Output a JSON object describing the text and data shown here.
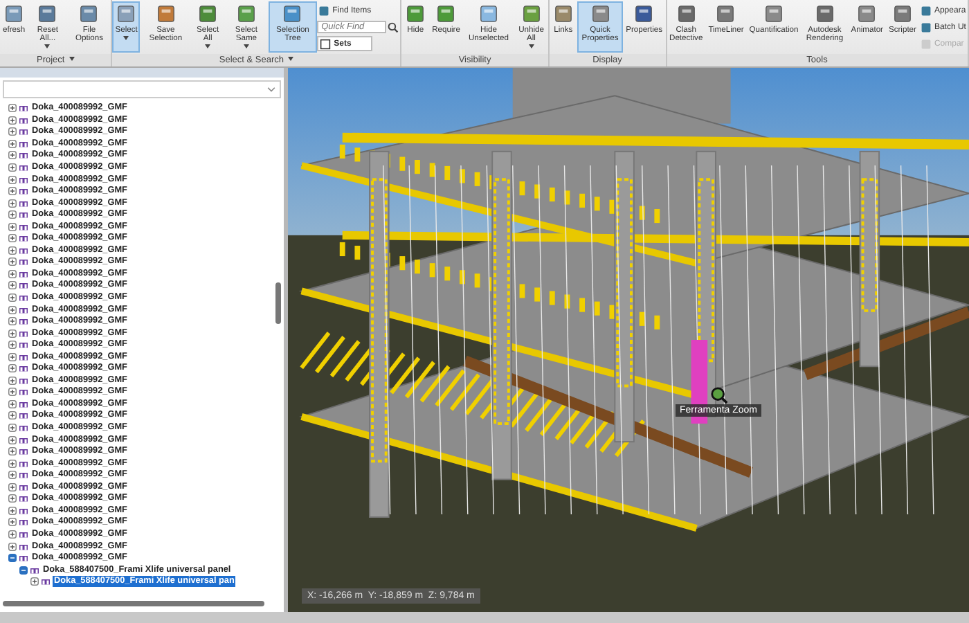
{
  "ribbon": {
    "groups": [
      {
        "label": "Project",
        "menu": true,
        "items": [
          {
            "kind": "large",
            "label": "efresh",
            "selected": false,
            "arrow": false
          },
          {
            "kind": "large",
            "label": "Reset All...",
            "selected": false,
            "arrow": true
          },
          {
            "kind": "large",
            "label": "File Options",
            "selected": false,
            "arrow": false
          }
        ]
      },
      {
        "label": "Select & Search",
        "menu": true,
        "items": [
          {
            "kind": "large",
            "label": "Select",
            "selected": true,
            "arrow": true
          },
          {
            "kind": "large",
            "label": "Save Selection",
            "selected": false,
            "arrow": false
          },
          {
            "kind": "large",
            "label": "Select All",
            "selected": false,
            "arrow": true
          },
          {
            "kind": "large",
            "label": "Select Same",
            "selected": false,
            "arrow": true
          },
          {
            "kind": "large",
            "label": "Selection Tree",
            "selected": true,
            "arrow": false
          },
          {
            "kind": "column",
            "items": [
              {
                "kind": "small",
                "label": "Find Items",
                "disabled": false
              },
              {
                "kind": "search",
                "placeholder": "Quick Find"
              },
              {
                "kind": "dropdown",
                "label": "Sets"
              }
            ]
          }
        ]
      },
      {
        "label": "Visibility",
        "menu": false,
        "items": [
          {
            "kind": "large",
            "label": "Hide",
            "selected": false,
            "arrow": false
          },
          {
            "kind": "large",
            "label": "Require",
            "selected": false,
            "arrow": false
          },
          {
            "kind": "large",
            "label": "Hide Unselected",
            "selected": false,
            "arrow": false
          },
          {
            "kind": "large",
            "label": "Unhide All",
            "selected": false,
            "arrow": true
          }
        ]
      },
      {
        "label": "Display",
        "menu": false,
        "items": [
          {
            "kind": "large",
            "label": "Links",
            "selected": false,
            "arrow": false
          },
          {
            "kind": "large",
            "label": "Quick Properties",
            "selected": true,
            "arrow": false
          },
          {
            "kind": "large",
            "label": "Properties",
            "selected": false,
            "arrow": false
          }
        ]
      },
      {
        "label": "Tools",
        "menu": false,
        "items": [
          {
            "kind": "large",
            "label": "Clash Detective",
            "selected": false,
            "arrow": false
          },
          {
            "kind": "large",
            "label": "TimeLiner",
            "selected": false,
            "arrow": false
          },
          {
            "kind": "large",
            "label": "Quantification",
            "selected": false,
            "arrow": false
          },
          {
            "kind": "large",
            "label": "Autodesk Rendering",
            "selected": false,
            "arrow": false
          },
          {
            "kind": "large",
            "label": "Animator",
            "selected": false,
            "arrow": false
          },
          {
            "kind": "large",
            "label": "Scripter",
            "selected": false,
            "arrow": false
          },
          {
            "kind": "column",
            "items": [
              {
                "kind": "small",
                "label": "Appeara",
                "disabled": false
              },
              {
                "kind": "small",
                "label": "Batch Ut",
                "disabled": false
              },
              {
                "kind": "small",
                "label": "Compar",
                "disabled": true
              }
            ]
          }
        ]
      }
    ]
  },
  "tree": [
    {
      "label": "Doka_400089992_GMF",
      "expanded": false,
      "selected": false
    },
    {
      "label": "Doka_400089992_GMF",
      "expanded": false,
      "selected": false
    },
    {
      "label": "Doka_400089992_GMF",
      "expanded": false,
      "selected": false
    },
    {
      "label": "Doka_400089992_GMF",
      "expanded": false,
      "selected": false
    },
    {
      "label": "Doka_400089992_GMF",
      "expanded": false,
      "selected": false
    },
    {
      "label": "Doka_400089992_GMF",
      "expanded": false,
      "selected": false
    },
    {
      "label": "Doka_400089992_GMF",
      "expanded": false,
      "selected": false
    },
    {
      "label": "Doka_400089992_GMF",
      "expanded": false,
      "selected": false
    },
    {
      "label": "Doka_400089992_GMF",
      "expanded": false,
      "selected": false
    },
    {
      "label": "Doka_400089992_GMF",
      "expanded": false,
      "selected": false
    },
    {
      "label": "Doka_400089992_GMF",
      "expanded": false,
      "selected": false
    },
    {
      "label": "Doka_400089992_GMF",
      "expanded": false,
      "selected": false
    },
    {
      "label": "Doka_400089992_GMF",
      "expanded": false,
      "selected": false
    },
    {
      "label": "Doka_400089992_GMF",
      "expanded": false,
      "selected": false
    },
    {
      "label": "Doka_400089992_GMF",
      "expanded": false,
      "selected": false
    },
    {
      "label": "Doka_400089992_GMF",
      "expanded": false,
      "selected": false
    },
    {
      "label": "Doka_400089992_GMF",
      "expanded": false,
      "selected": false
    },
    {
      "label": "Doka_400089992_GMF",
      "expanded": false,
      "selected": false
    },
    {
      "label": "Doka_400089992_GMF",
      "expanded": false,
      "selected": false
    },
    {
      "label": "Doka_400089992_GMF",
      "expanded": false,
      "selected": false
    },
    {
      "label": "Doka_400089992_GMF",
      "expanded": false,
      "selected": false
    },
    {
      "label": "Doka_400089992_GMF",
      "expanded": false,
      "selected": false
    },
    {
      "label": "Doka_400089992_GMF",
      "expanded": false,
      "selected": false
    },
    {
      "label": "Doka_400089992_GMF",
      "expanded": false,
      "selected": false
    },
    {
      "label": "Doka_400089992_GMF",
      "expanded": false,
      "selected": false
    },
    {
      "label": "Doka_400089992_GMF",
      "expanded": false,
      "selected": false
    },
    {
      "label": "Doka_400089992_GMF",
      "expanded": false,
      "selected": false
    },
    {
      "label": "Doka_400089992_GMF",
      "expanded": false,
      "selected": false
    },
    {
      "label": "Doka_400089992_GMF",
      "expanded": false,
      "selected": false
    },
    {
      "label": "Doka_400089992_GMF",
      "expanded": false,
      "selected": false
    },
    {
      "label": "Doka_400089992_GMF",
      "expanded": false,
      "selected": false
    },
    {
      "label": "Doka_400089992_GMF",
      "expanded": false,
      "selected": false
    },
    {
      "label": "Doka_400089992_GMF",
      "expanded": false,
      "selected": false
    },
    {
      "label": "Doka_400089992_GMF",
      "expanded": false,
      "selected": false
    },
    {
      "label": "Doka_400089992_GMF",
      "expanded": false,
      "selected": false
    },
    {
      "label": "Doka_400089992_GMF",
      "expanded": false,
      "selected": false
    },
    {
      "label": "Doka_400089992_GMF",
      "expanded": false,
      "selected": false
    },
    {
      "label": "Doka_400089992_GMF",
      "expanded": false,
      "selected": false
    },
    {
      "label": "Doka_400089992_GMF",
      "expanded": true,
      "selected": false,
      "children": [
        {
          "label": "Doka_588407500_Frami Xlife universal panel",
          "expanded": true,
          "selected": false,
          "children": [
            {
              "label": "Doka_588407500_Frami Xlife universal pan",
              "expanded": false,
              "selected": true
            }
          ]
        }
      ]
    }
  ],
  "viewport": {
    "tooltip": "Ferramenta Zoom",
    "coordinates": "X: -16,266 m  Y: -18,859 m  Z: 9,784 m"
  }
}
